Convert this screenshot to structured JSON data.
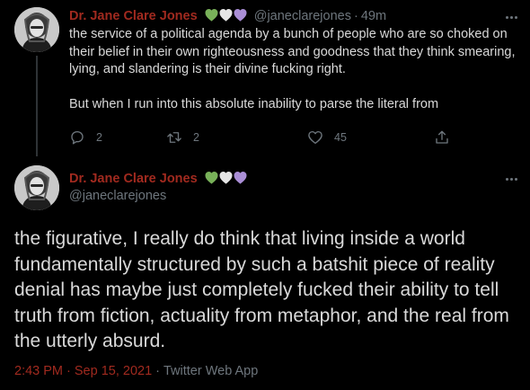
{
  "colors": {
    "background": "#000000",
    "text": "#d9d9d9",
    "muted": "#6e767d",
    "accent": "#a12a1f",
    "heart_green": "#78b159",
    "heart_white": "#e6e6e6",
    "heart_purple": "#aa8ed6"
  },
  "reply_tweet": {
    "author_name": "Dr. Jane Clare Jones",
    "author_handle": "@janeclarejones",
    "time_separator": "·",
    "relative_time": "49m",
    "hearts": [
      "green-heart-icon",
      "white-heart-icon",
      "purple-heart-icon"
    ],
    "body_paragraph_1": "the service of a political agenda by a bunch of people who are so choked on their belief in their own righteousness and goodness that they think smearing, lying, and slandering is their divine fucking right.",
    "body_paragraph_2": "But when I run into this absolute inability to parse the literal from",
    "actions": {
      "reply_count": "2",
      "retweet_count": "2",
      "like_count": "45"
    }
  },
  "main_tweet": {
    "author_name": "Dr. Jane Clare Jones",
    "author_handle": "@janeclarejones",
    "hearts": [
      "green-heart-icon",
      "white-heart-icon",
      "purple-heart-icon"
    ],
    "body": "the figurative, I really do think that living inside a world fundamentally structured by such a batshit piece of reality denial has maybe just completely fucked their ability to tell truth from fiction, actuality from metaphor, and the real from the utterly absurd.",
    "timestamp": "2:43 PM · Sep 15, 2021",
    "meta_separator": "·",
    "source_app": "Twitter Web App"
  }
}
